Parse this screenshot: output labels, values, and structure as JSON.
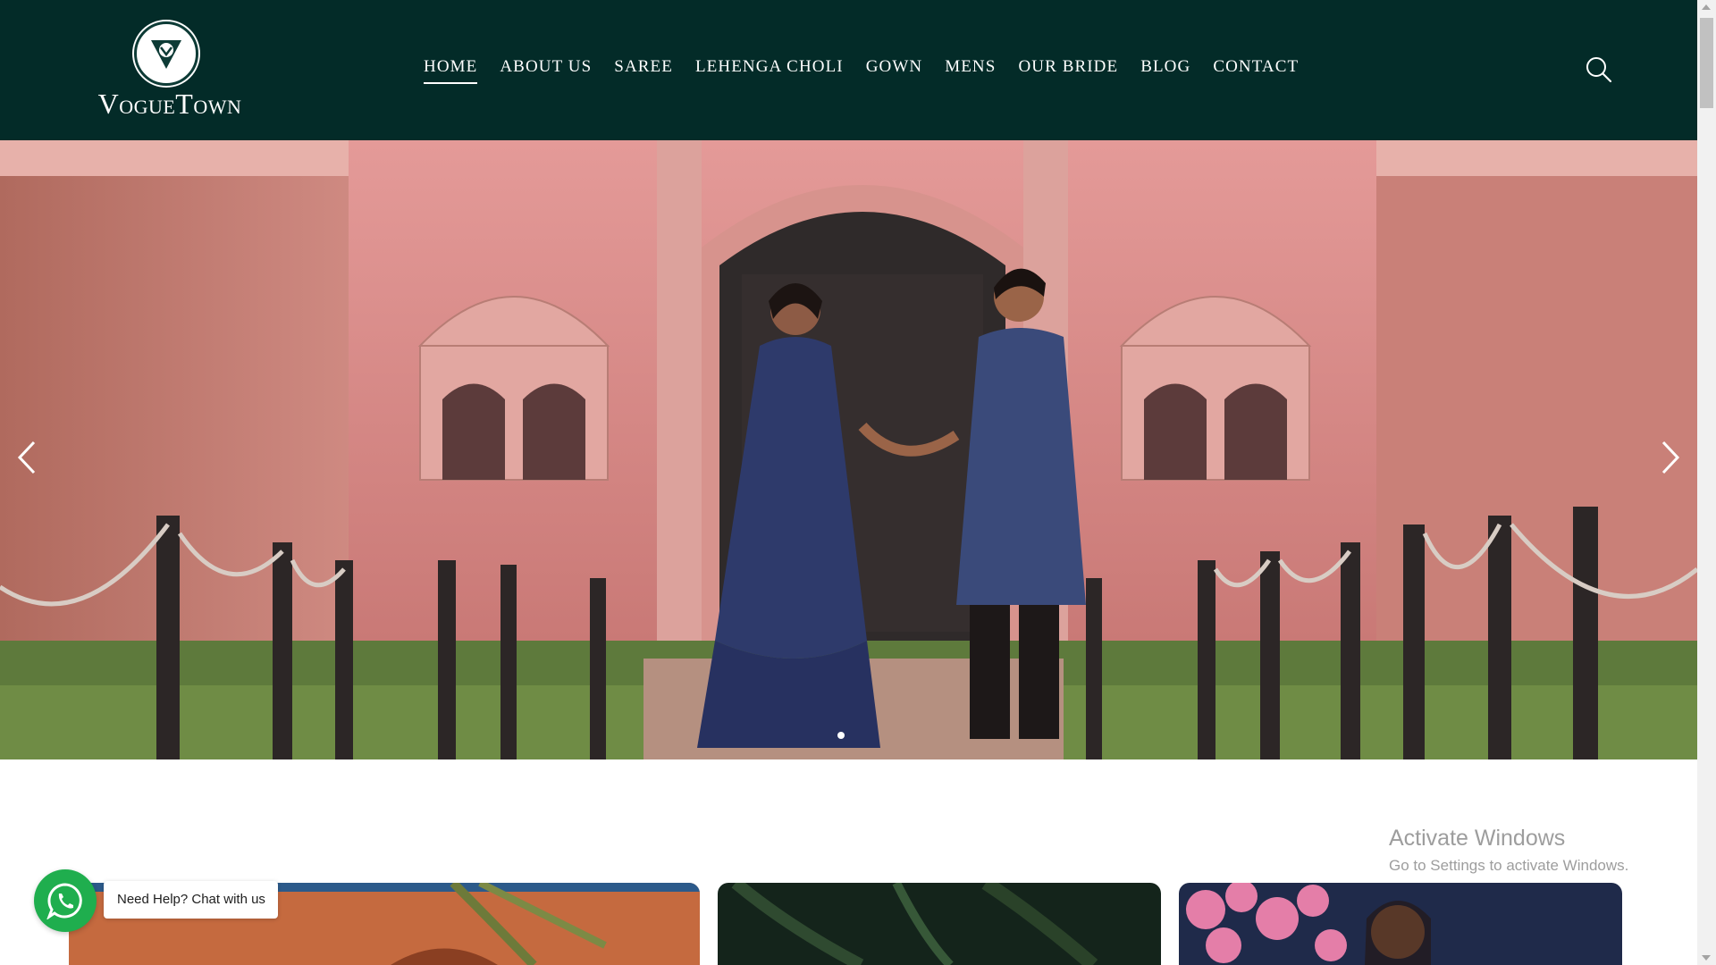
{
  "header": {
    "logo_text": "VogueTown",
    "nav": [
      {
        "label": "HOME",
        "active": true
      },
      {
        "label": "ABOUT US"
      },
      {
        "label": "SAREE"
      },
      {
        "label": "LEHENGA CHOLI"
      },
      {
        "label": "GOWN"
      },
      {
        "label": "MENS"
      },
      {
        "label": "OUR BRIDE"
      },
      {
        "label": "BLOG"
      },
      {
        "label": "CONTACT"
      }
    ],
    "search_icon": "search-icon"
  },
  "hero": {
    "prev_icon": "chevron-left-icon",
    "next_icon": "chevron-right-icon",
    "slide_count": 1,
    "active_slide": 1
  },
  "whatsapp": {
    "icon": "whatsapp-icon",
    "label": "Need Help? Chat with us"
  },
  "watermark": {
    "title": "Activate Windows",
    "subtitle": "Go to Settings to activate Windows."
  },
  "colors": {
    "header_bg": "#032b28",
    "nav_text": "#ffffff",
    "whatsapp_green": "#1fae4e",
    "hero_wall": "#d98a8a"
  }
}
